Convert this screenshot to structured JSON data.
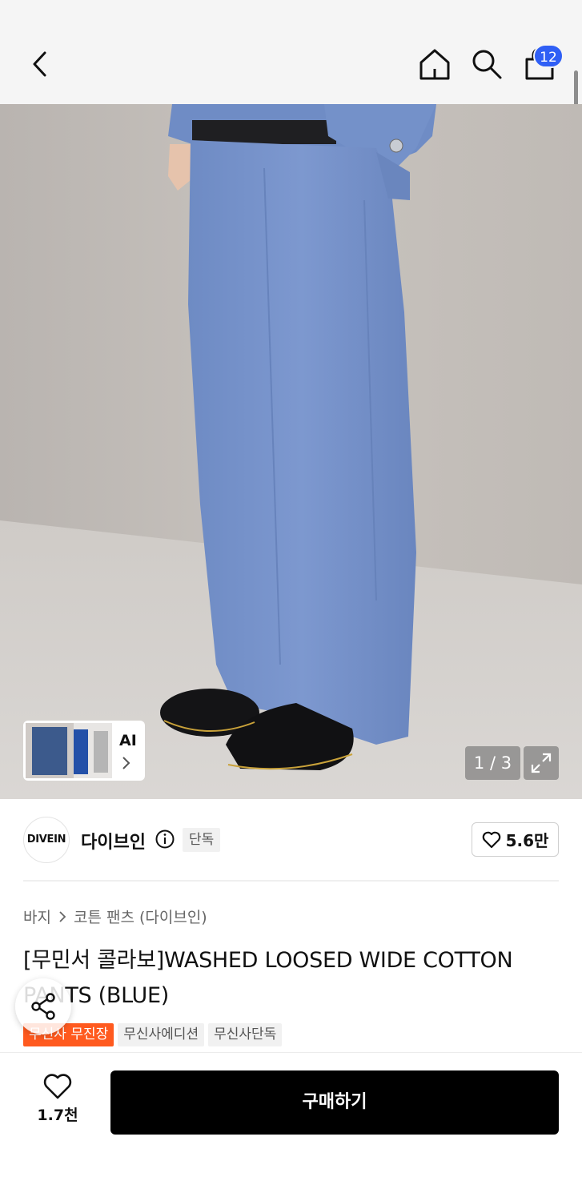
{
  "header": {
    "back_icon": "chevron-left-icon",
    "home_icon": "home-icon",
    "search_icon": "search-icon",
    "cart_icon": "shopping-bag-icon",
    "cart_count": "12",
    "badge_color": "#2f5ff5"
  },
  "hero": {
    "image_subject": "model wearing wide blue washed cotton pants with black leather shoes",
    "ai_label": "AI",
    "page_indicator": "1 / 3",
    "expand_icon": "expand-icon"
  },
  "brand": {
    "logo_text": "DIVEIN",
    "name": "다이브인",
    "badge": "단독",
    "like_count": "5.6만"
  },
  "breadcrumb": [
    "바지",
    "코튼 팬츠 (다이브인)"
  ],
  "product": {
    "title": "[무민서 콜라보]WASHED LOOSED WIDE COTTON PANTS (BLUE)",
    "tags": [
      "무신사 무진장",
      "무신사에디션",
      "무신사단독"
    ],
    "tag_accent": "#ff5a1f"
  },
  "bottom_bar": {
    "wish_count": "1.7천",
    "buy_label": "구매하기"
  }
}
